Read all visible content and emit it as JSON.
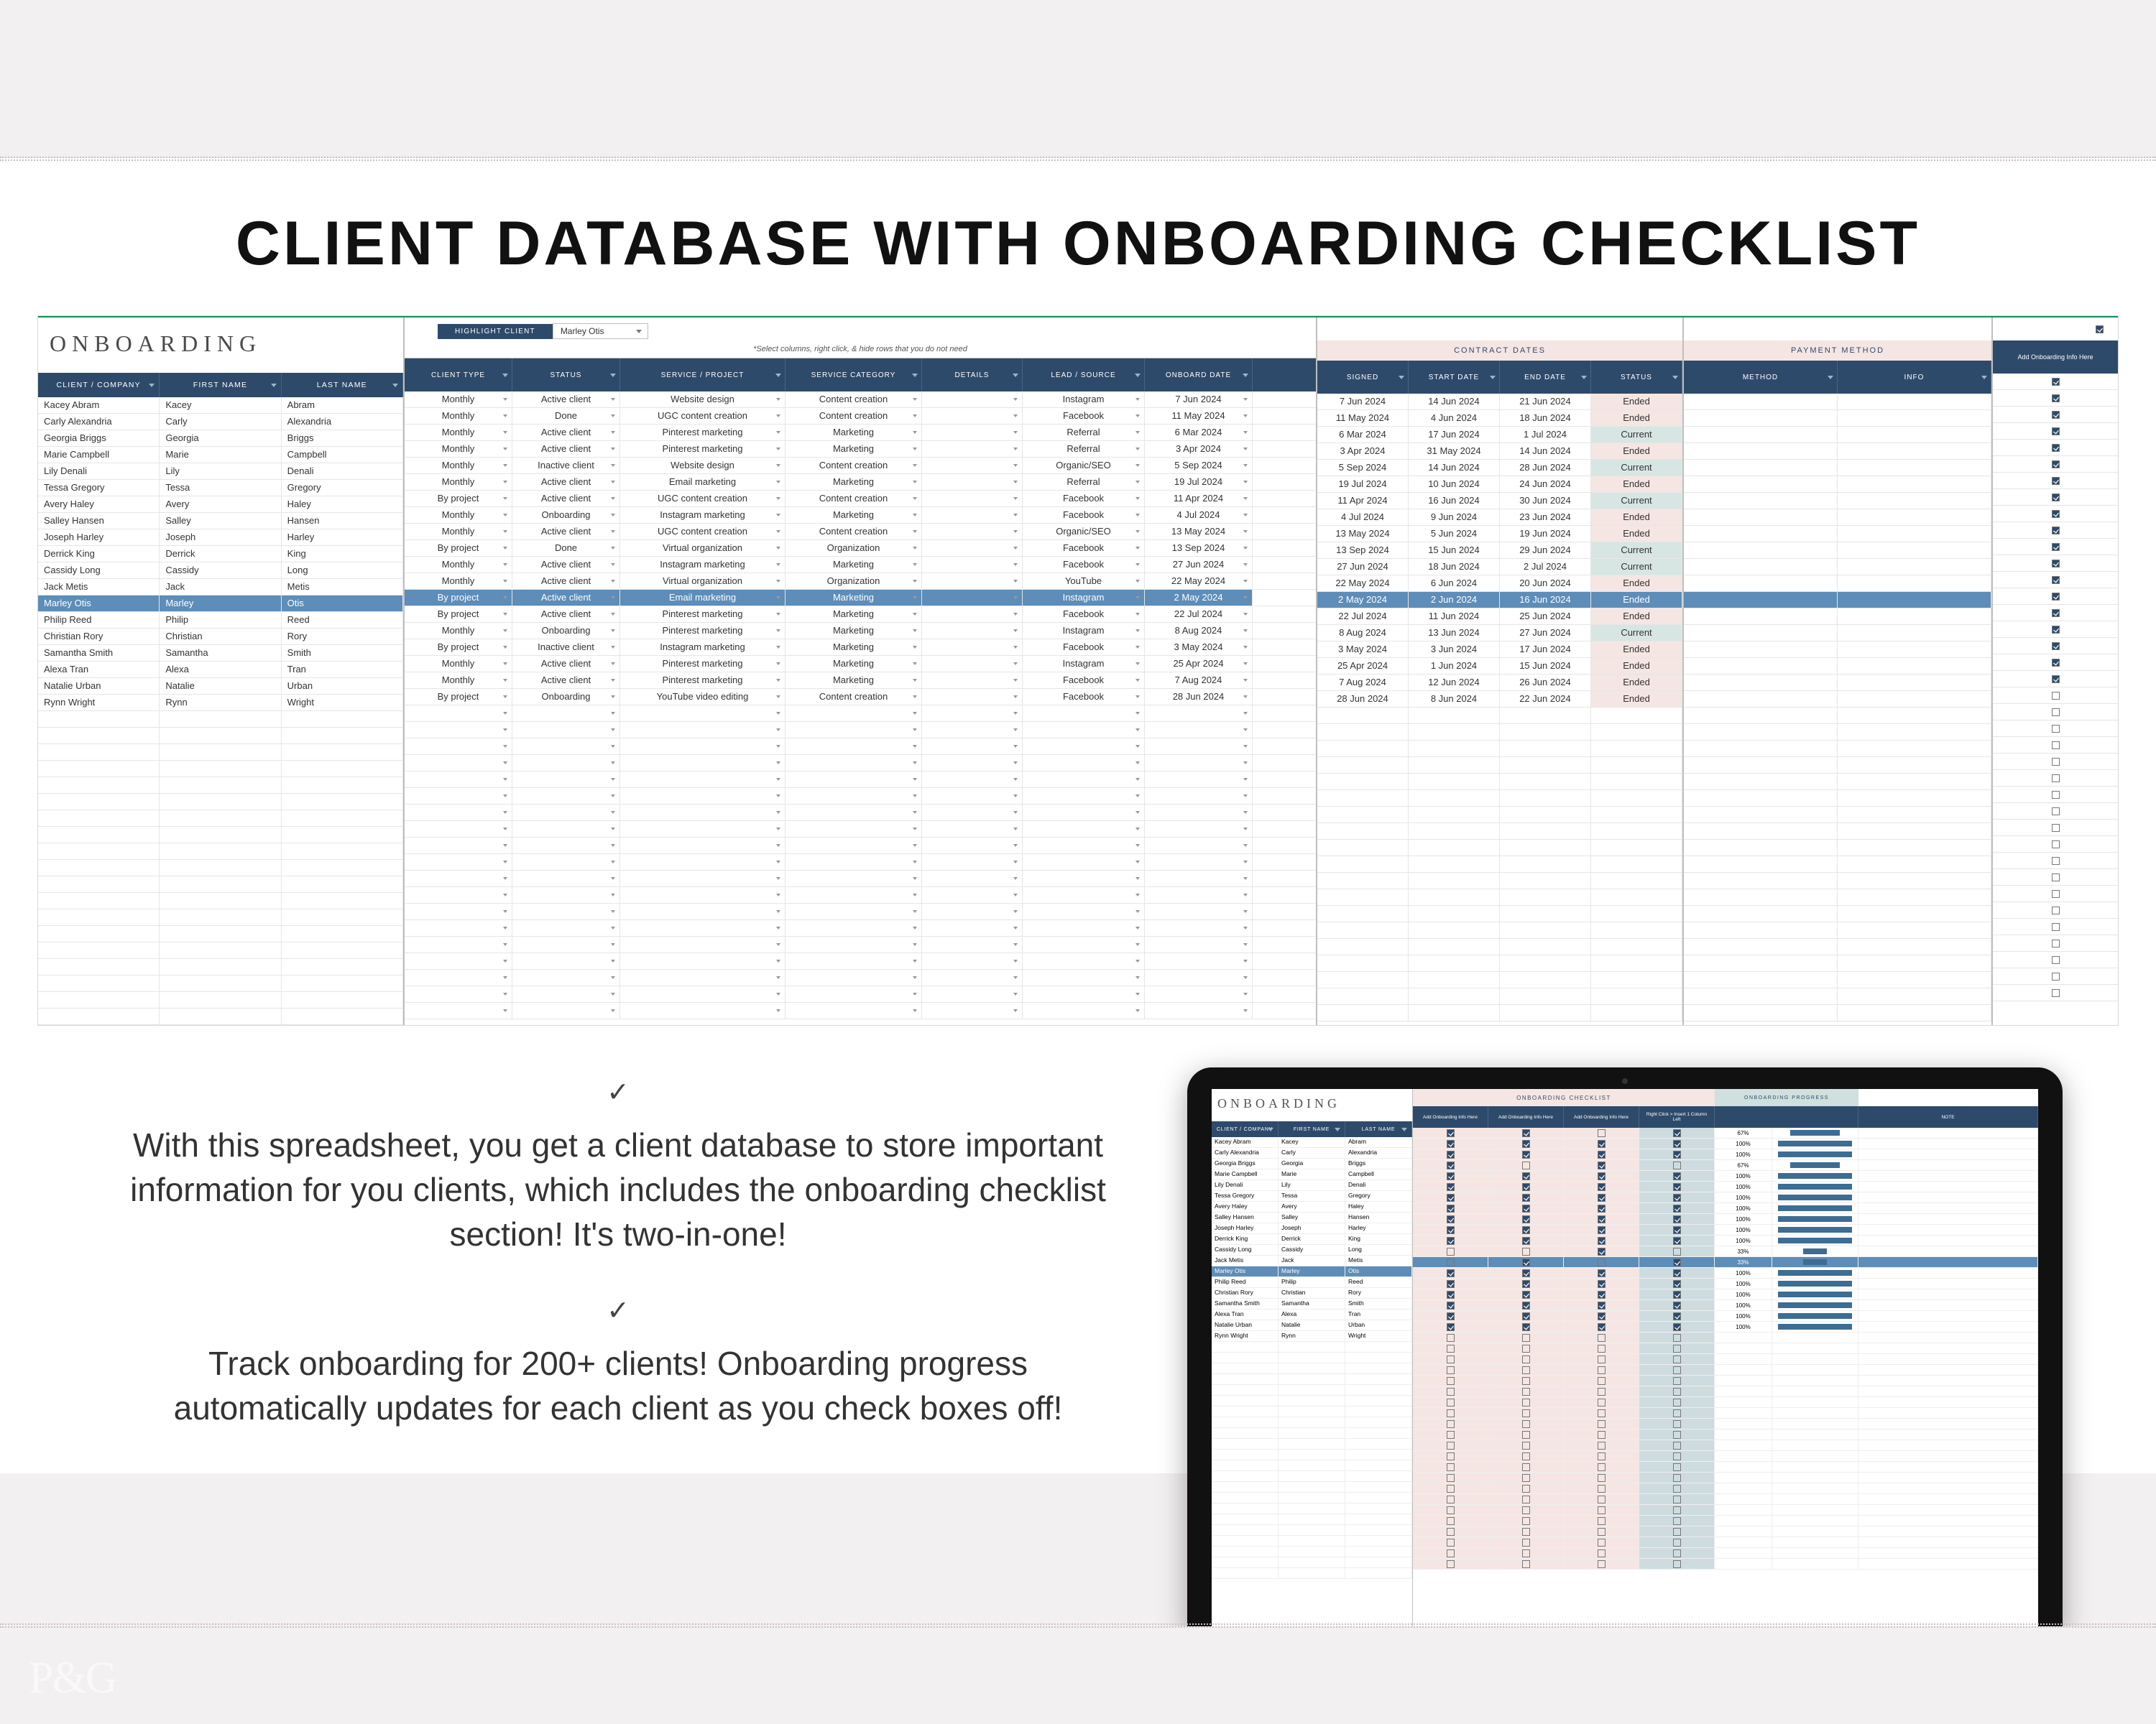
{
  "headline": "CLIENT DATABASE WITH ONBOARDING CHECKLIST",
  "panel_title": "ONBOARDING",
  "highlight": {
    "label": "HIGHLIGHT CLIENT",
    "selected": "Marley Otis"
  },
  "hint": "*Select columns, right click, & hide rows that you do not need",
  "headersA": [
    "CLIENT / COMPANY",
    "FIRST NAME",
    "LAST NAME"
  ],
  "headersB": [
    "CLIENT TYPE",
    "STATUS",
    "SERVICE / PROJECT",
    "SERVICE CATEGORY",
    "DETAILS",
    "LEAD / SOURCE",
    "ONBOARD DATE"
  ],
  "sectC": "CONTRACT DATES",
  "headersC": [
    "SIGNED",
    "START DATE",
    "END DATE",
    "STATUS"
  ],
  "sectD": "PAYMENT METHOD",
  "headersD": [
    "METHOD",
    "INFO"
  ],
  "headerE": "Add Onboarding Info Here",
  "rows": [
    {
      "name": "Kacey Abram",
      "fn": "Kacey",
      "ln": "Abram",
      "type": "Monthly",
      "status": "Active client",
      "svc": "Website design",
      "cat": "Content creation",
      "lead": "Instagram",
      "ob": "7 Jun 2024",
      "signed": "7 Jun 2024",
      "start": "14 Jun 2024",
      "end": "21 Jun 2024",
      "cs": "Ended",
      "cb": true
    },
    {
      "name": "Carly Alexandria",
      "fn": "Carly",
      "ln": "Alexandria",
      "type": "Monthly",
      "status": "Done",
      "svc": "UGC content creation",
      "cat": "Content creation",
      "lead": "Facebook",
      "ob": "11 May 2024",
      "signed": "11 May 2024",
      "start": "4 Jun 2024",
      "end": "18 Jun 2024",
      "cs": "Ended",
      "cb": true
    },
    {
      "name": "Georgia Briggs",
      "fn": "Georgia",
      "ln": "Briggs",
      "type": "Monthly",
      "status": "Active client",
      "svc": "Pinterest marketing",
      "cat": "Marketing",
      "lead": "Referral",
      "ob": "6 Mar 2024",
      "signed": "6 Mar 2024",
      "start": "17 Jun 2024",
      "end": "1 Jul 2024",
      "cs": "Current",
      "cb": true
    },
    {
      "name": "Marie Campbell",
      "fn": "Marie",
      "ln": "Campbell",
      "type": "Monthly",
      "status": "Active client",
      "svc": "Pinterest marketing",
      "cat": "Marketing",
      "lead": "Referral",
      "ob": "3 Apr 2024",
      "signed": "3 Apr 2024",
      "start": "31 May 2024",
      "end": "14 Jun 2024",
      "cs": "Ended",
      "cb": true
    },
    {
      "name": "Lily Denali",
      "fn": "Lily",
      "ln": "Denali",
      "type": "Monthly",
      "status": "Inactive client",
      "svc": "Website design",
      "cat": "Content creation",
      "lead": "Organic/SEO",
      "ob": "5 Sep 2024",
      "signed": "5 Sep 2024",
      "start": "14 Jun 2024",
      "end": "28 Jun 2024",
      "cs": "Current",
      "cb": true
    },
    {
      "name": "Tessa Gregory",
      "fn": "Tessa",
      "ln": "Gregory",
      "type": "Monthly",
      "status": "Active client",
      "svc": "Email marketing",
      "cat": "Marketing",
      "lead": "Referral",
      "ob": "19 Jul 2024",
      "signed": "19 Jul 2024",
      "start": "10 Jun 2024",
      "end": "24 Jun 2024",
      "cs": "Ended",
      "cb": true
    },
    {
      "name": "Avery Haley",
      "fn": "Avery",
      "ln": "Haley",
      "type": "By project",
      "status": "Active client",
      "svc": "UGC content creation",
      "cat": "Content creation",
      "lead": "Facebook",
      "ob": "11 Apr 2024",
      "signed": "11 Apr 2024",
      "start": "16 Jun 2024",
      "end": "30 Jun 2024",
      "cs": "Current",
      "cb": true
    },
    {
      "name": "Salley Hansen",
      "fn": "Salley",
      "ln": "Hansen",
      "type": "Monthly",
      "status": "Onboarding",
      "svc": "Instagram marketing",
      "cat": "Marketing",
      "lead": "Facebook",
      "ob": "4 Jul 2024",
      "signed": "4 Jul 2024",
      "start": "9 Jun 2024",
      "end": "23 Jun 2024",
      "cs": "Ended",
      "cb": true
    },
    {
      "name": "Joseph Harley",
      "fn": "Joseph",
      "ln": "Harley",
      "type": "Monthly",
      "status": "Active client",
      "svc": "UGC content creation",
      "cat": "Content creation",
      "lead": "Organic/SEO",
      "ob": "13 May 2024",
      "signed": "13 May 2024",
      "start": "5 Jun 2024",
      "end": "19 Jun 2024",
      "cs": "Ended",
      "cb": true
    },
    {
      "name": "Derrick King",
      "fn": "Derrick",
      "ln": "King",
      "type": "By project",
      "status": "Done",
      "svc": "Virtual organization",
      "cat": "Organization",
      "lead": "Facebook",
      "ob": "13 Sep 2024",
      "signed": "13 Sep 2024",
      "start": "15 Jun 2024",
      "end": "29 Jun 2024",
      "cs": "Current",
      "cb": true
    },
    {
      "name": "Cassidy Long",
      "fn": "Cassidy",
      "ln": "Long",
      "type": "Monthly",
      "status": "Active client",
      "svc": "Instagram marketing",
      "cat": "Marketing",
      "lead": "Facebook",
      "ob": "27 Jun 2024",
      "signed": "27 Jun 2024",
      "start": "18 Jun 2024",
      "end": "2 Jul 2024",
      "cs": "Current",
      "cb": true
    },
    {
      "name": "Jack Metis",
      "fn": "Jack",
      "ln": "Metis",
      "type": "Monthly",
      "status": "Active client",
      "svc": "Virtual organization",
      "cat": "Organization",
      "lead": "YouTube",
      "ob": "22 May 2024",
      "signed": "22 May 2024",
      "start": "6 Jun 2024",
      "end": "20 Jun 2024",
      "cs": "Ended",
      "cb": true
    },
    {
      "name": "Marley Otis",
      "fn": "Marley",
      "ln": "Otis",
      "type": "By project",
      "status": "Active client",
      "svc": "Email marketing",
      "cat": "Marketing",
      "lead": "Instagram",
      "ob": "2 May 2024",
      "signed": "2 May 2024",
      "start": "2 Jun 2024",
      "end": "16 Jun 2024",
      "cs": "Ended",
      "cb": true,
      "hl": true
    },
    {
      "name": "Philip Reed",
      "fn": "Philip",
      "ln": "Reed",
      "type": "By project",
      "status": "Active client",
      "svc": "Pinterest marketing",
      "cat": "Marketing",
      "lead": "Facebook",
      "ob": "22 Jul 2024",
      "signed": "22 Jul 2024",
      "start": "11 Jun 2024",
      "end": "25 Jun 2024",
      "cs": "Ended",
      "cb": true
    },
    {
      "name": "Christian Rory",
      "fn": "Christian",
      "ln": "Rory",
      "type": "Monthly",
      "status": "Onboarding",
      "svc": "Pinterest marketing",
      "cat": "Marketing",
      "lead": "Instagram",
      "ob": "8 Aug 2024",
      "signed": "8 Aug 2024",
      "start": "13 Jun 2024",
      "end": "27 Jun 2024",
      "cs": "Current",
      "cb": true
    },
    {
      "name": "Samantha Smith",
      "fn": "Samantha",
      "ln": "Smith",
      "type": "By project",
      "status": "Inactive client",
      "svc": "Instagram marketing",
      "cat": "Marketing",
      "lead": "Facebook",
      "ob": "3 May 2024",
      "signed": "3 May 2024",
      "start": "3 Jun 2024",
      "end": "17 Jun 2024",
      "cs": "Ended",
      "cb": true
    },
    {
      "name": "Alexa Tran",
      "fn": "Alexa",
      "ln": "Tran",
      "type": "Monthly",
      "status": "Active client",
      "svc": "Pinterest marketing",
      "cat": "Marketing",
      "lead": "Instagram",
      "ob": "25 Apr 2024",
      "signed": "25 Apr 2024",
      "start": "1 Jun 2024",
      "end": "15 Jun 2024",
      "cs": "Ended",
      "cb": true
    },
    {
      "name": "Natalie Urban",
      "fn": "Natalie",
      "ln": "Urban",
      "type": "Monthly",
      "status": "Active client",
      "svc": "Pinterest marketing",
      "cat": "Marketing",
      "lead": "Facebook",
      "ob": "7 Aug 2024",
      "signed": "7 Aug 2024",
      "start": "12 Jun 2024",
      "end": "26 Jun 2024",
      "cs": "Ended",
      "cb": true
    },
    {
      "name": "Rynn Wright",
      "fn": "Rynn",
      "ln": "Wright",
      "type": "By project",
      "status": "Onboarding",
      "svc": "YouTube video editing",
      "cat": "Content creation",
      "lead": "Facebook",
      "ob": "28 Jun 2024",
      "signed": "28 Jun 2024",
      "start": "8 Jun 2024",
      "end": "22 Jun 2024",
      "cs": "Ended",
      "cb": true
    }
  ],
  "empty_rows": 19,
  "copy1": "With this spreadsheet, you get a client database to store important information for you clients, which includes the onboarding checklist section! It's two-in-one!",
  "copy2": "Track onboarding for 200+ clients! Onboarding progress automatically updates for each client as you check boxes off!",
  "laptop": {
    "title": "ONBOARDING",
    "headersA": [
      "CLIENT / COMPANY",
      "FIRST NAME",
      "LAST NAME"
    ],
    "sect1": "ONBOARDING CHECKLIST",
    "sect2": "ONBOARDING PROGRESS",
    "headersB": [
      "Add Onboarding Info Here",
      "Add Onboarding Info Here",
      "Add Onboarding Info Here",
      "Right Click > Insert 1 Column Left",
      "",
      "NOTE"
    ],
    "rows": [
      {
        "name": "Kacey Abram",
        "fn": "Kacey",
        "ln": "Abram",
        "c": [
          1,
          1,
          0,
          1
        ],
        "pct": "67%"
      },
      {
        "name": "Carly Alexandria",
        "fn": "Carly",
        "ln": "Alexandria",
        "c": [
          1,
          1,
          1,
          1
        ],
        "pct": "100%"
      },
      {
        "name": "Georgia Briggs",
        "fn": "Georgia",
        "ln": "Briggs",
        "c": [
          1,
          1,
          1,
          1
        ],
        "pct": "100%"
      },
      {
        "name": "Marie Campbell",
        "fn": "Marie",
        "ln": "Campbell",
        "c": [
          1,
          0,
          1,
          0
        ],
        "pct": "67%"
      },
      {
        "name": "Lily Denali",
        "fn": "Lily",
        "ln": "Denali",
        "c": [
          1,
          1,
          1,
          1
        ],
        "pct": "100%"
      },
      {
        "name": "Tessa Gregory",
        "fn": "Tessa",
        "ln": "Gregory",
        "c": [
          1,
          1,
          1,
          1
        ],
        "pct": "100%"
      },
      {
        "name": "Avery Haley",
        "fn": "Avery",
        "ln": "Haley",
        "c": [
          1,
          1,
          1,
          1
        ],
        "pct": "100%"
      },
      {
        "name": "Salley Hansen",
        "fn": "Salley",
        "ln": "Hansen",
        "c": [
          1,
          1,
          1,
          1
        ],
        "pct": "100%"
      },
      {
        "name": "Joseph Harley",
        "fn": "Joseph",
        "ln": "Harley",
        "c": [
          1,
          1,
          1,
          1
        ],
        "pct": "100%"
      },
      {
        "name": "Derrick King",
        "fn": "Derrick",
        "ln": "King",
        "c": [
          1,
          1,
          1,
          1
        ],
        "pct": "100%"
      },
      {
        "name": "Cassidy Long",
        "fn": "Cassidy",
        "ln": "Long",
        "c": [
          1,
          1,
          1,
          1
        ],
        "pct": "100%"
      },
      {
        "name": "Jack Metis",
        "fn": "Jack",
        "ln": "Metis",
        "c": [
          0,
          0,
          1,
          0
        ],
        "pct": "33%"
      },
      {
        "name": "Marley Otis",
        "fn": "Marley",
        "ln": "Otis",
        "c": [
          0,
          1,
          0,
          1
        ],
        "pct": "33%",
        "hl": true
      },
      {
        "name": "Philip Reed",
        "fn": "Philip",
        "ln": "Reed",
        "c": [
          1,
          1,
          1,
          1
        ],
        "pct": "100%"
      },
      {
        "name": "Christian Rory",
        "fn": "Christian",
        "ln": "Rory",
        "c": [
          1,
          1,
          1,
          1
        ],
        "pct": "100%"
      },
      {
        "name": "Samantha Smith",
        "fn": "Samantha",
        "ln": "Smith",
        "c": [
          1,
          1,
          1,
          1
        ],
        "pct": "100%"
      },
      {
        "name": "Alexa Tran",
        "fn": "Alexa",
        "ln": "Tran",
        "c": [
          1,
          1,
          1,
          1
        ],
        "pct": "100%"
      },
      {
        "name": "Natalie Urban",
        "fn": "Natalie",
        "ln": "Urban",
        "c": [
          1,
          1,
          1,
          1
        ],
        "pct": "100%"
      },
      {
        "name": "Rynn Wright",
        "fn": "Rynn",
        "ln": "Wright",
        "c": [
          1,
          1,
          1,
          1
        ],
        "pct": "100%"
      }
    ],
    "empty_rows": 22
  },
  "logo": "P&G"
}
